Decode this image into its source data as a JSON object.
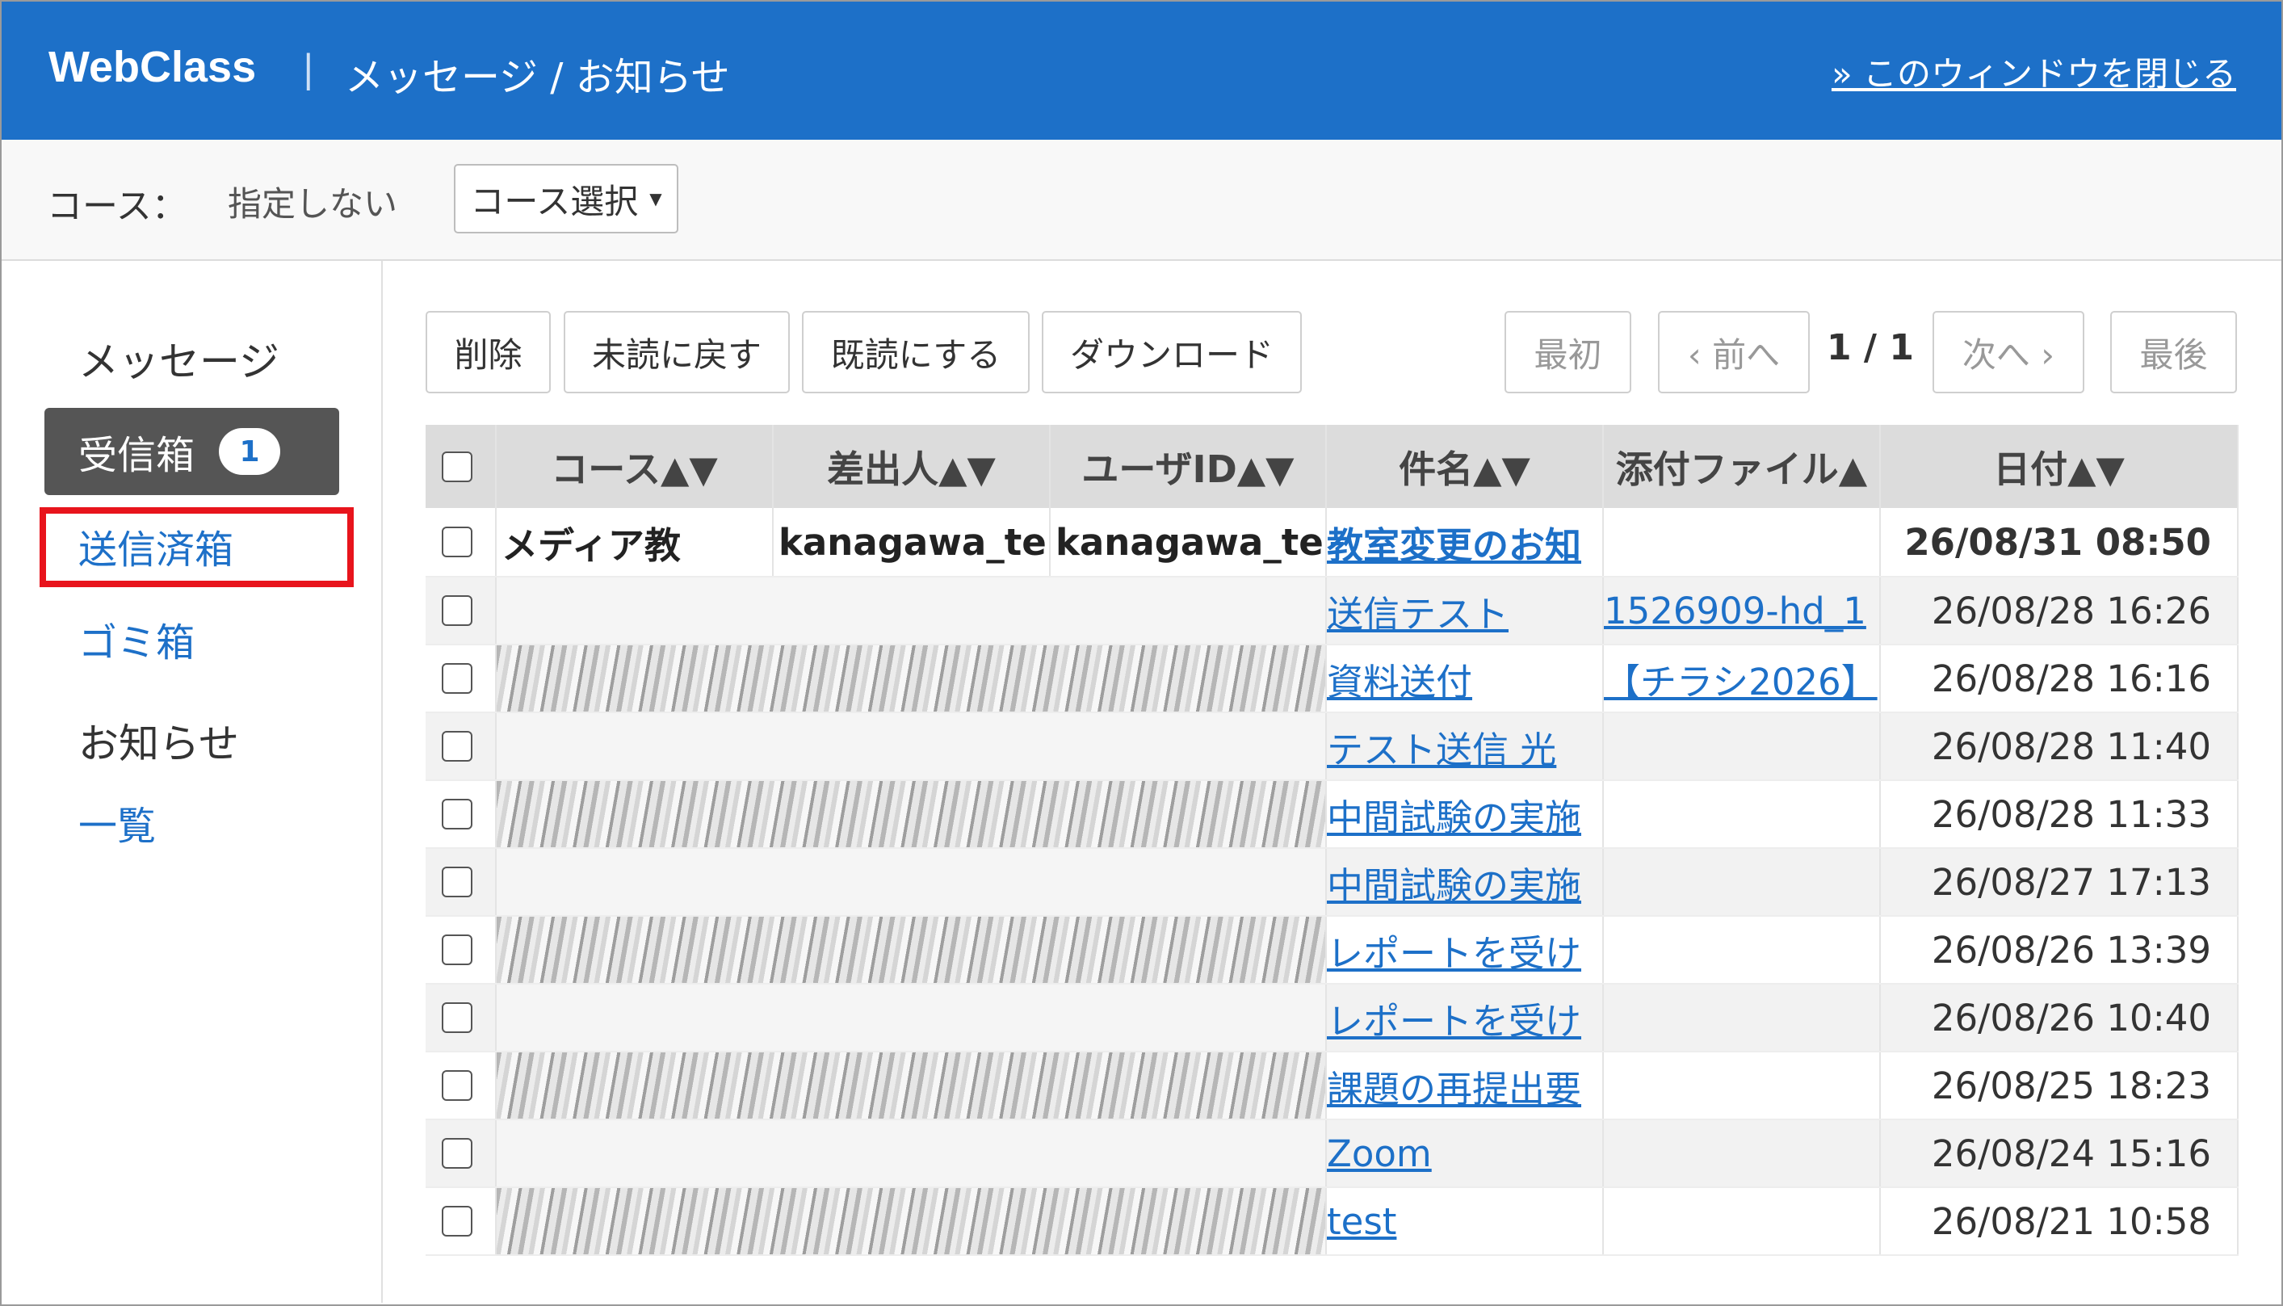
{
  "header": {
    "logo": "WebClass",
    "separator": "|",
    "title": "メッセージ / お知らせ",
    "close_link": "» このウィンドウを閉じる"
  },
  "course_bar": {
    "label": "コース：",
    "value": "指定しない",
    "select_button": "コース選択",
    "select_caret": "▼"
  },
  "sidebar": {
    "messages_heading": "メッセージ",
    "inbox_label": "受信箱",
    "inbox_badge": "1",
    "sent_label": "送信済箱",
    "trash_label": "ゴミ箱",
    "notices_heading": "お知らせ",
    "list_label": "一覧"
  },
  "toolbar": {
    "delete": "削除",
    "mark_unread": "未読に戻す",
    "mark_read": "既読にする",
    "download": "ダウンロード",
    "first": "最初",
    "prev": "‹ 前へ",
    "page_info": "1 / 1",
    "next": "次へ ›",
    "last": "最後"
  },
  "table": {
    "headers": [
      "コース▲▼",
      "差出人▲▼",
      "ユーザID▲▼",
      "件名▲▼",
      "添付ファイル▲",
      "日付▲▼"
    ],
    "rows": [
      {
        "course": "メディア教",
        "sender": "kanagawa_te",
        "userid": "kanagawa_te",
        "subject": "教室変更のお知",
        "attachment": "",
        "date": "26/08/31 08:50",
        "unread": true
      },
      {
        "subject": "送信テスト",
        "attachment": "1526909-hd_1",
        "date": "26/08/28 16:26"
      },
      {
        "subject": "資料送付",
        "attachment": "【チラシ2026】",
        "date": "26/08/28 16:16"
      },
      {
        "subject": "テスト送信 光",
        "attachment": "",
        "date": "26/08/28 11:40"
      },
      {
        "subject": "中間試験の実施",
        "attachment": "",
        "date": "26/08/28 11:33"
      },
      {
        "subject": "中間試験の実施",
        "attachment": "",
        "date": "26/08/27 17:13"
      },
      {
        "subject": "レポートを受け",
        "attachment": "",
        "date": "26/08/26 13:39"
      },
      {
        "subject": "レポートを受け",
        "attachment": "",
        "date": "26/08/26 10:40"
      },
      {
        "subject": "課題の再提出要",
        "attachment": "",
        "date": "26/08/25 18:23"
      },
      {
        "subject": "Zoom",
        "attachment": "",
        "date": "26/08/24 15:16"
      },
      {
        "subject": "test",
        "attachment": "",
        "date": "26/08/21 10:58"
      }
    ]
  },
  "colors": {
    "header_bg": "#1d70c8",
    "link": "#1d70c8",
    "inbox_active_bg": "#555555",
    "highlight_box": "#e8141c"
  }
}
